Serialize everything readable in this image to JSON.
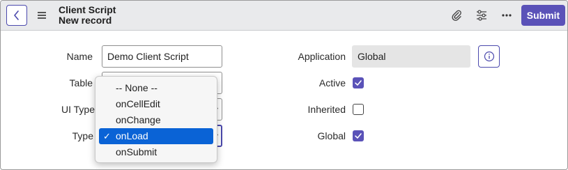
{
  "header": {
    "title": "Client Script",
    "subtitle": "New record",
    "submit_label": "Submit"
  },
  "icons": {
    "back": "chevron-left-icon",
    "menu": "hamburger-menu-icon",
    "attachment": "paperclip-icon",
    "settings": "sliders-icon",
    "more": "more-options-icon",
    "info": "info-icon"
  },
  "colors": {
    "accent": "#5a52b8",
    "header_bg": "#e9eaec",
    "selection": "#0a63d6"
  },
  "form": {
    "name": {
      "label": "Name",
      "value": "Demo Client Script"
    },
    "table": {
      "label": "Table"
    },
    "ui_type": {
      "label": "UI Type"
    },
    "type": {
      "label": "Type"
    },
    "application": {
      "label": "Application",
      "value": "Global"
    },
    "active": {
      "label": "Active",
      "checked": true
    },
    "inherited": {
      "label": "Inherited",
      "checked": false
    },
    "global": {
      "label": "Global",
      "checked": true
    }
  },
  "type_dropdown": {
    "options": [
      "-- None --",
      "onCellEdit",
      "onChange",
      "onLoad",
      "onSubmit"
    ],
    "selected": "onLoad",
    "check_mark": "✓"
  }
}
